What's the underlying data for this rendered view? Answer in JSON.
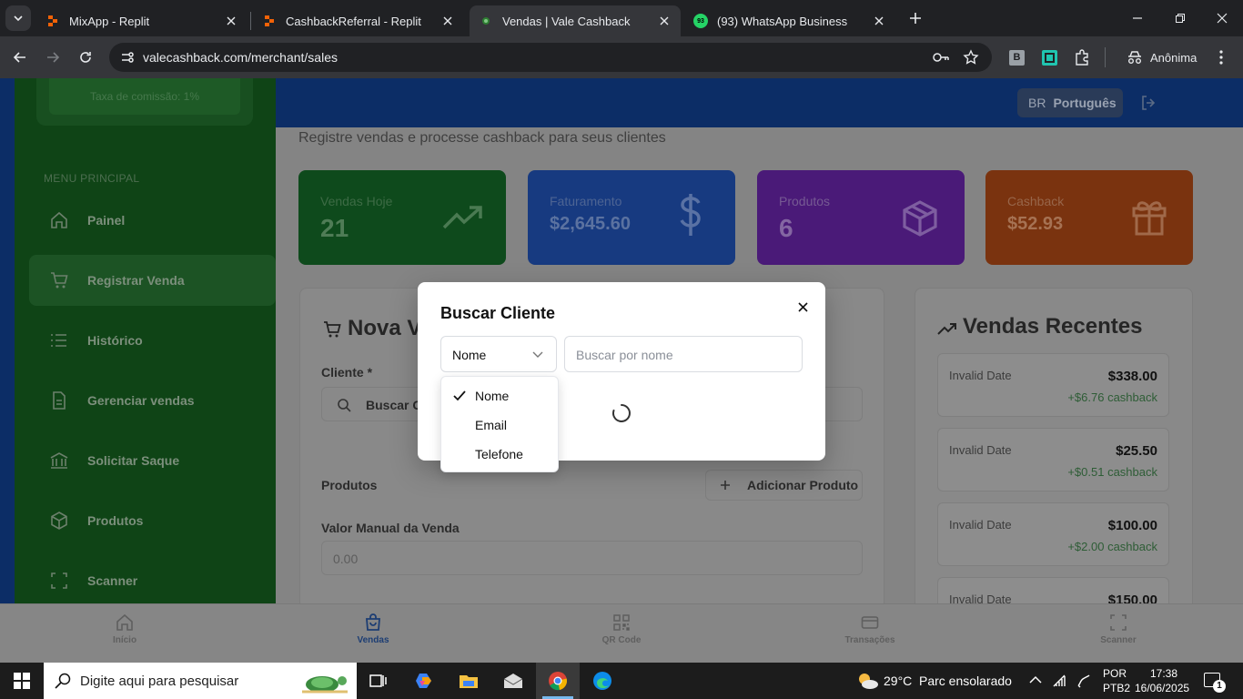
{
  "browser": {
    "tabs": [
      {
        "title": "MixApp - Replit",
        "active": false
      },
      {
        "title": "CashbackReferral - Replit",
        "active": false
      },
      {
        "title": "Vendas | Vale Cashback",
        "active": true
      },
      {
        "title": "(93) WhatsApp Business",
        "active": false
      }
    ],
    "whatsapp_badge": "93",
    "url": "valecashback.com/merchant/sales",
    "profile_label": "Anônima",
    "ext_b_label": "B"
  },
  "page": {
    "language_flag": "BR",
    "language": "Português",
    "subtitle": "Registre vendas e processe cashback para seus clientes",
    "commission": "Taxa de comissão: 1%",
    "menu_heading": "MENU PRINCIPAL",
    "nav": [
      {
        "label": "Painel",
        "icon": "home-icon"
      },
      {
        "label": "Registrar Venda",
        "icon": "cart-icon",
        "active": true
      },
      {
        "label": "Histórico",
        "icon": "list-icon"
      },
      {
        "label": "Gerenciar vendas",
        "icon": "document-icon"
      },
      {
        "label": "Solicitar Saque",
        "icon": "bank-icon"
      },
      {
        "label": "Produtos",
        "icon": "box-icon"
      },
      {
        "label": "Scanner",
        "icon": "scan-icon"
      }
    ],
    "stats": [
      {
        "label": "Vendas Hoje",
        "value": "21",
        "icon": "trending-up-icon",
        "color": "#0e4a1c"
      },
      {
        "label": "Faturamento",
        "value": "$2,645.60",
        "icon": "dollar-icon",
        "color": "#173a80"
      },
      {
        "label": "Produtos",
        "value": "6",
        "icon": "box-icon",
        "color": "#4a1a78"
      },
      {
        "label": "Cashback",
        "value": "$52.93",
        "icon": "gift-icon",
        "color": "#7a330f"
      }
    ],
    "new_sale_title": "Nova Venda",
    "client_label": "Cliente *",
    "client_search": "Buscar Cliente",
    "products_label": "Produtos",
    "add_product": "Adicionar Produto",
    "manual_value_label": "Valor Manual da Venda",
    "manual_value_placeholder": "0.00",
    "recent_title": "Vendas Recentes",
    "recent_sales": [
      {
        "date": "Invalid Date",
        "amount": "$338.00",
        "cashback": "+$6.76 cashback"
      },
      {
        "date": "Invalid Date",
        "amount": "$25.50",
        "cashback": "+$0.51 cashback"
      },
      {
        "date": "Invalid Date",
        "amount": "$100.00",
        "cashback": "+$2.00 cashback"
      },
      {
        "date": "Invalid Date",
        "amount": "$150.00",
        "cashback": ""
      }
    ],
    "bottom_nav": [
      {
        "label": "Início",
        "icon": "home-icon"
      },
      {
        "label": "Vendas",
        "icon": "bag-icon",
        "active": true
      },
      {
        "label": "QR Code",
        "icon": "qr-icon"
      },
      {
        "label": "Transações",
        "icon": "card-icon"
      },
      {
        "label": "Scanner",
        "icon": "scan-icon"
      }
    ]
  },
  "modal": {
    "title": "Buscar Cliente",
    "select_value": "Nome",
    "search_placeholder": "Buscar por nome",
    "options": [
      "Nome",
      "Email",
      "Telefone"
    ],
    "selected_option": "Nome"
  },
  "taskbar": {
    "search_placeholder": "Digite aqui para pesquisar",
    "temperature": "29°C",
    "weather": "Parc ensolarado",
    "lang": "POR",
    "layout": "PTB2",
    "time": "17:38",
    "date": "16/06/2025",
    "notifications": "1"
  }
}
